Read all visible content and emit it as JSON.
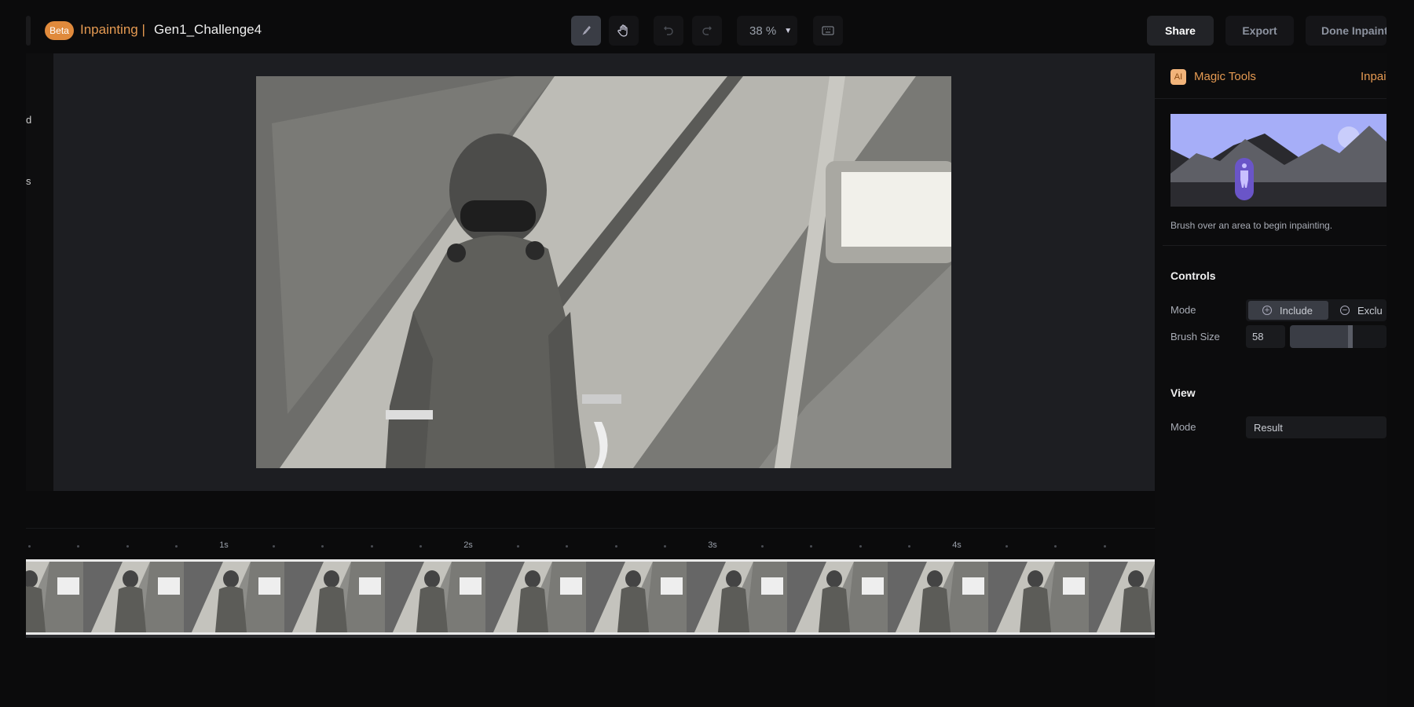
{
  "header": {
    "badge": "Beta",
    "section": "Inpainting |",
    "project": "Gen1_Challenge4",
    "zoom": "38 %",
    "share": "Share",
    "export": "Export",
    "done": "Done Inpaint"
  },
  "toolbar": {
    "tools": [
      "brush-icon",
      "hand-icon",
      "undo-icon",
      "redo-icon",
      "keyboard-icon"
    ],
    "active": "brush"
  },
  "left_panel": {
    "fragments": [
      "d",
      "s"
    ]
  },
  "right_panel": {
    "ai_badge": "AI",
    "title": "Magic Tools",
    "tab": "Inpai",
    "hint": "Brush over an area to begin inpainting.",
    "controls_heading": "Controls",
    "mode_label": "Mode",
    "include": "Include",
    "exclude": "Exclu",
    "brush_size_label": "Brush Size",
    "brush_size": "58",
    "brush_slider_fraction": 0.58,
    "view_heading": "View",
    "view_mode_label": "Mode",
    "view_mode": "Result"
  },
  "timeline": {
    "ticks": [
      "1s",
      "2s",
      "3s",
      "4s"
    ]
  },
  "colors": {
    "accent": "#e08a3c",
    "panel": "#0c0c0d",
    "canvas": "#1d1e22"
  }
}
